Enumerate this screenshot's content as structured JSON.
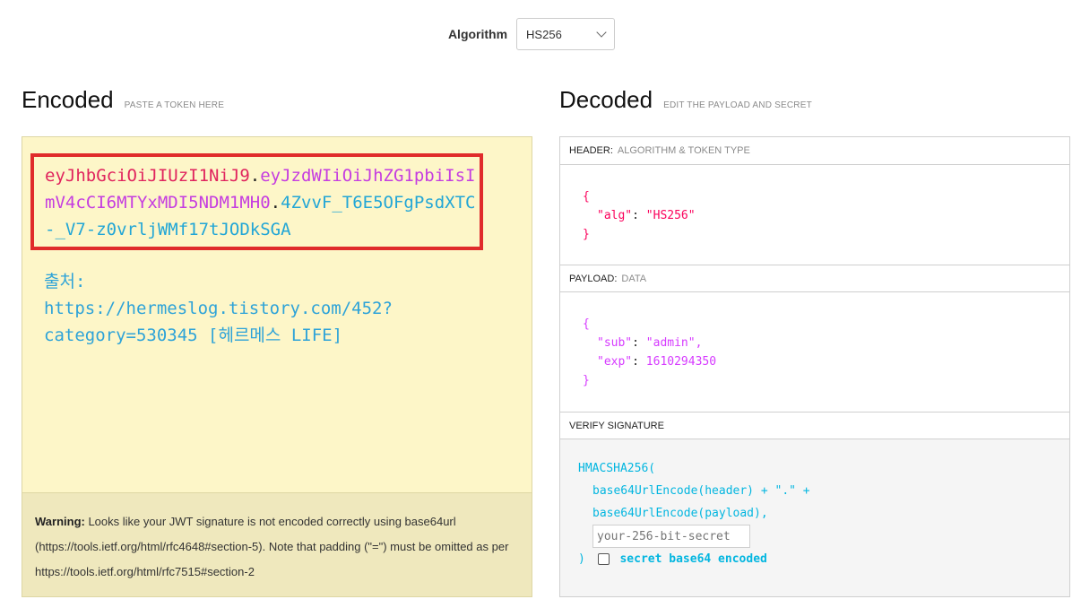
{
  "algorithm": {
    "label": "Algorithm",
    "selected": "HS256"
  },
  "encoded": {
    "title": "Encoded",
    "subtitle": "PASTE A TOKEN HERE",
    "token": {
      "header": "eyJhbGciOiJIUzI1NiJ9",
      "payload": "eyJzdWIiOiJhZG1pbiIsImV4cCI6MTYxMDI5NDM1MH0",
      "signature": "4ZvvF_T6E5OFgPsdXTC-_V7-z0vrljWMf17tJODkSGA",
      "dot": "."
    },
    "source_text": "출처:\nhttps://hermeslog.tistory.com/452?category=530345 [헤르메스 LIFE]",
    "warning": {
      "label": "Warning:",
      "text": " Looks like your JWT signature is not encoded correctly using base64url (https://tools.ietf.org/html/rfc4648#section-5). Note that padding (\"=\") must be omitted as per https://tools.ietf.org/html/rfc7515#section-2"
    }
  },
  "decoded": {
    "title": "Decoded",
    "subtitle": "EDIT THE PAYLOAD AND SECRET",
    "header_section": {
      "label": "HEADER:",
      "sub": "ALGORITHM & TOKEN TYPE",
      "alg_key": "\"alg\"",
      "alg_value": "\"HS256\""
    },
    "payload_section": {
      "label": "PAYLOAD:",
      "sub": "DATA",
      "sub_key": "\"sub\"",
      "sub_value": "\"admin\",",
      "exp_key": "\"exp\"",
      "exp_value": "1610294350"
    },
    "verify_section": {
      "label": "VERIFY SIGNATURE",
      "line1": "HMACSHA256(",
      "line2": "base64UrlEncode(header) + \".\" +",
      "line3": "base64UrlEncode(payload),",
      "secret_placeholder": "your-256-bit-secret",
      "close": ")",
      "checkbox_label": "secret base64 encoded"
    }
  },
  "colors": {
    "header": "#fb015b",
    "payload": "#d63aff",
    "signature": "#03b6e0",
    "highlight_border": "#e02b2b"
  }
}
